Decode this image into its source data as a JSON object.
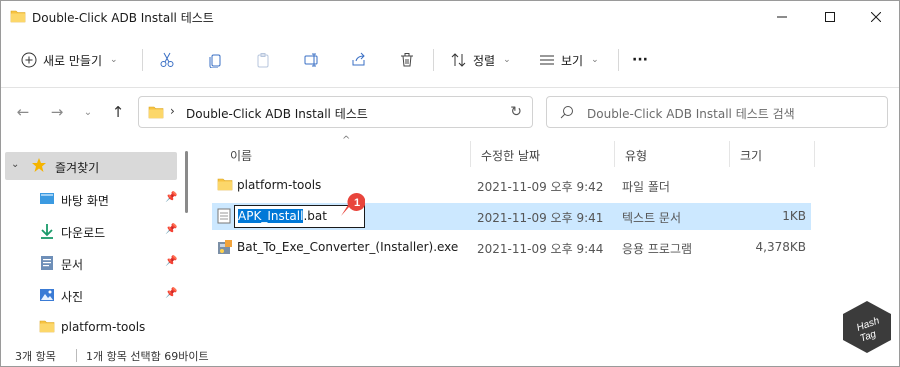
{
  "window": {
    "title": "Double-Click ADB Install 테스트",
    "minimize_icon": "minimize-icon",
    "maximize_icon": "maximize-icon",
    "close_icon": "close-icon"
  },
  "toolbar": {
    "new_label": "새로 만들기",
    "sort_label": "정렬",
    "view_label": "보기",
    "more_label": "···"
  },
  "address": {
    "path": "Double-Click ADB Install 테스트",
    "search_placeholder": "Double-Click ADB Install 테스트 검색"
  },
  "sidebar": {
    "items": [
      {
        "label": "즐겨찾기",
        "icon": "star-icon"
      },
      {
        "label": "바탕 화면",
        "icon": "desktop-icon"
      },
      {
        "label": "다운로드",
        "icon": "download-icon"
      },
      {
        "label": "문서",
        "icon": "document-icon"
      },
      {
        "label": "사진",
        "icon": "pictures-icon"
      },
      {
        "label": "platform-tools",
        "icon": "folder-icon"
      }
    ]
  },
  "columns": {
    "name": "이름",
    "date": "수정한 날짜",
    "type": "유형",
    "size": "크기"
  },
  "files": [
    {
      "name": "platform-tools",
      "date": "2021-11-09 오후 9:42",
      "type": "파일 폴더",
      "size": ""
    },
    {
      "name": "APK_Install.bat",
      "rename_base": "APK_Install",
      "rename_ext": ".bat",
      "date": "2021-11-09 오후 9:41",
      "type": "텍스트 문서",
      "size": "1KB"
    },
    {
      "name": "Bat_To_Exe_Converter_(Installer).exe",
      "date": "2021-11-09 오후 9:44",
      "type": "응용 프로그램",
      "size": "4,378KB"
    }
  ],
  "callout": {
    "number": "1"
  },
  "status": {
    "items_count": "3개 항목",
    "selection": "1개 항목 선택함 69바이트"
  },
  "watermark": {
    "line1": "Hash",
    "line2": "Tag"
  },
  "colors": {
    "selection": "#cce8ff",
    "accent": "#0078d7",
    "callout": "#e8453c",
    "folder": "#f7c342"
  }
}
